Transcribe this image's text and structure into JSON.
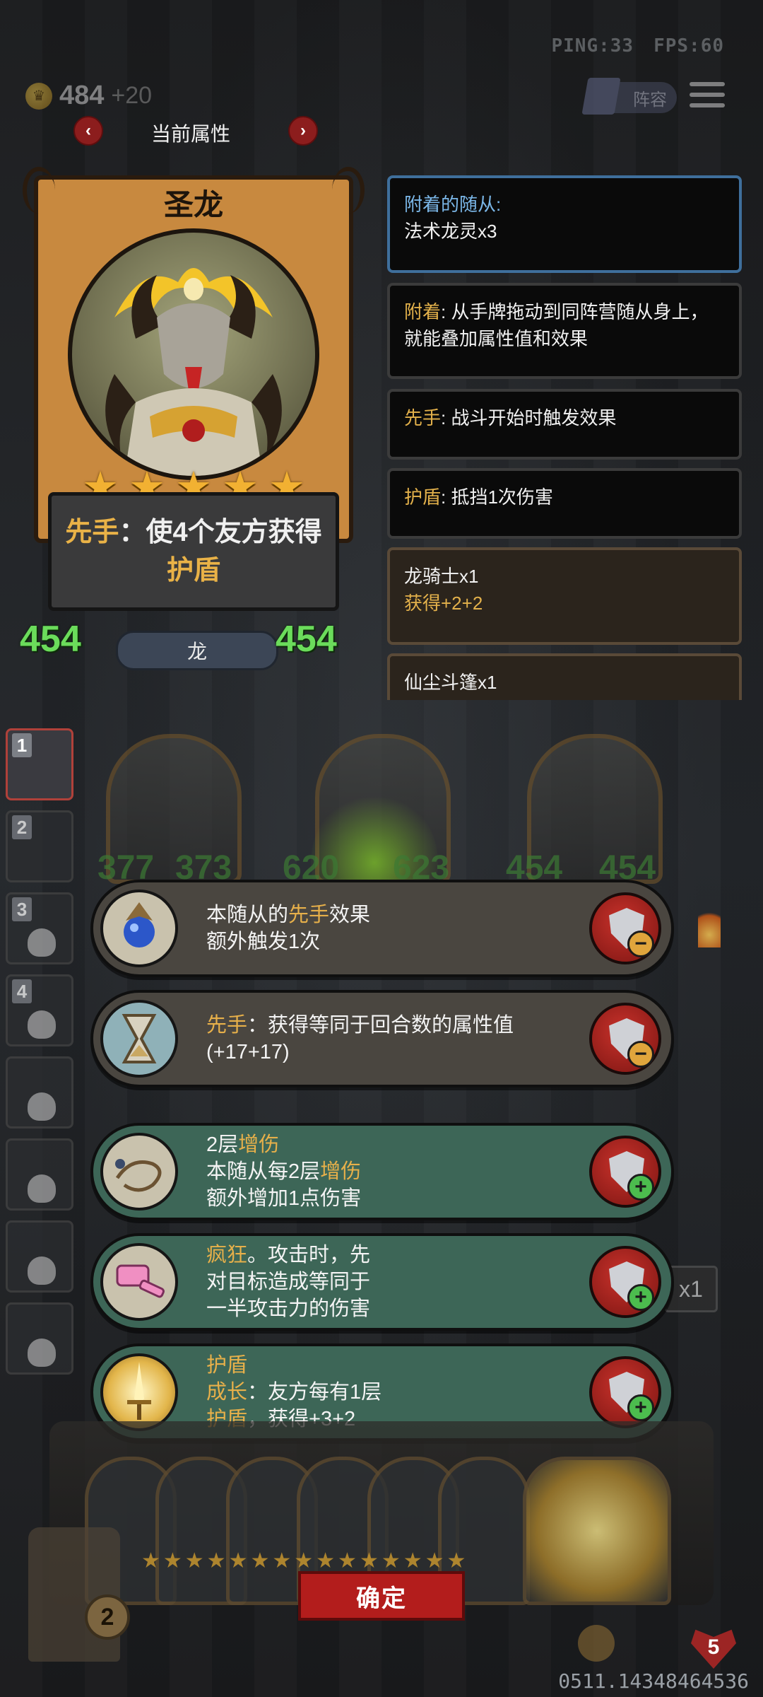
{
  "status": {
    "ping": "PING:33",
    "fps": "FPS:60"
  },
  "currency": {
    "coins": "484",
    "gain": "+20"
  },
  "topbar": {
    "lineup_label": "阵容"
  },
  "attributes": {
    "title": "当前属性"
  },
  "unit": {
    "name": "圣龙",
    "stars": 5,
    "desc_pre": "先手",
    "desc_mid": "：使4个友方获得",
    "desc_kw": "护盾",
    "attack": "454",
    "health": "454",
    "tribe": "龙"
  },
  "info": {
    "attached_label": "附着的随从:",
    "attached_value": "法术龙灵x3",
    "attach_kw": "附着",
    "attach_desc": ": 从手牌拖动到同阵营随从身上，就能叠加属性值和效果",
    "first_kw": "先手",
    "first_desc": ": 战斗开始时触发效果",
    "shield_kw": "护盾",
    "shield_desc": ": 抵挡1次伤害",
    "item1_name": "龙骑士x1",
    "item1_gain": "获得+2+2",
    "item2_name": "仙尘斗篷x1"
  },
  "board": {
    "slots": [
      "1",
      "2",
      "3",
      "4"
    ],
    "ghost_stats": [
      "377",
      "373",
      "620",
      "623",
      "454",
      "454"
    ],
    "counter": "x1"
  },
  "effects": [
    {
      "line1_pre": "本随从的",
      "line1_kw": "先手",
      "line1_post": "效果",
      "line2": "额外触发1次",
      "line3": "",
      "button": "minus",
      "icon": "blue-orb-icon"
    },
    {
      "line1_pre": "",
      "line1_kw": "先手",
      "line1_post": "：获得等同于回合数的属性值",
      "line2": "(+17+17)",
      "line3": "",
      "button": "minus",
      "icon": "hourglass-icon"
    },
    {
      "line1_pre": "2层",
      "line1_kw": "增伤",
      "line1_post": "",
      "line2_pre": "本随从每2层",
      "line2_kw": "增伤",
      "line3": "额外增加1点伤害",
      "button": "plus",
      "icon": "whip-icon"
    },
    {
      "line1_pre": "",
      "line1_kw": "疯狂",
      "line1_post": "。攻击时，先",
      "line2": "对目标造成等同于",
      "line3": "一半攻击力的伤害",
      "button": "plus",
      "icon": "hammer-icon"
    },
    {
      "line1_pre": "",
      "line1_kw": "护盾",
      "line1_post": "",
      "line2_kw": "成长",
      "line2_post": "：友方每有1层",
      "line3_kw": "护盾",
      "line3_post": "，获得+3+2",
      "button": "plus",
      "icon": "golden-sword-icon"
    }
  ],
  "bottom": {
    "confirm": "确定",
    "chest_count": "2",
    "lives": "5",
    "code": "0511.14348464536"
  }
}
